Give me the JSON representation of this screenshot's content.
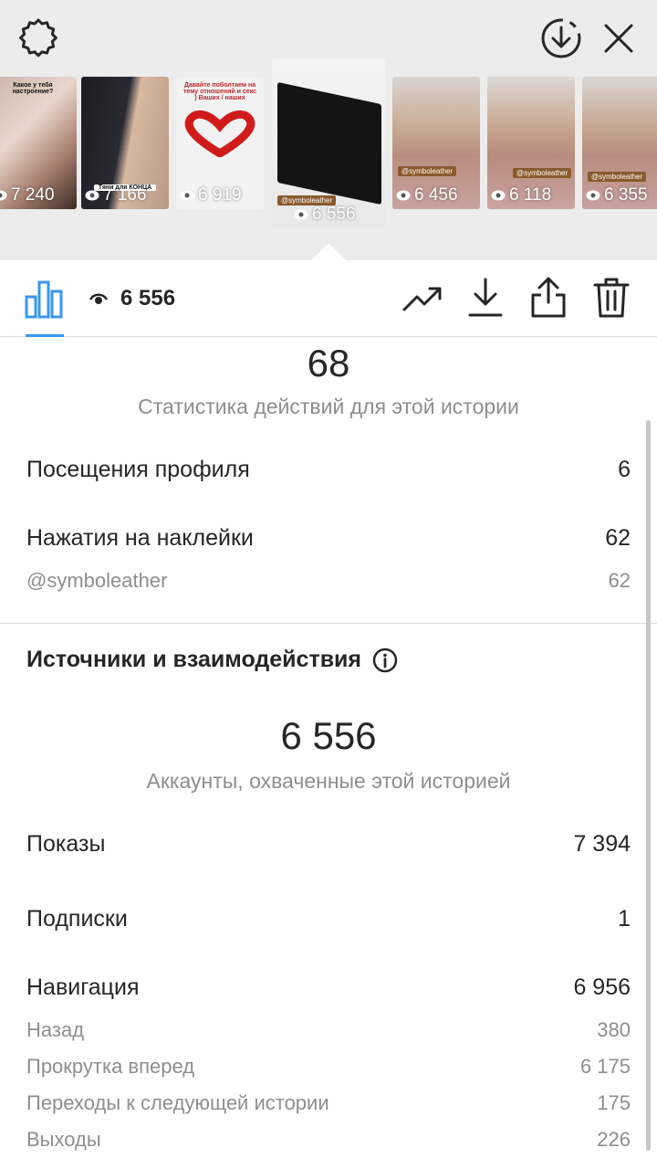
{
  "header": {
    "thumbnails": [
      {
        "views": "7 240",
        "caption": "Какое у тебя настроение?"
      },
      {
        "views": "7 166",
        "caption": "Тяни для КОНЦА"
      },
      {
        "views": "6 919",
        "caption": "Давайте поболтаем на тему отношений и секс ) Ваших / наших"
      },
      {
        "views": "6 556",
        "tag": "@symboleather"
      },
      {
        "views": "6 456",
        "tag": "@symboleather"
      },
      {
        "views": "6 118",
        "tag": "@symboleather"
      },
      {
        "views": "6 355",
        "tag": "@symboleather"
      }
    ]
  },
  "toolbar": {
    "view_count": "6 556"
  },
  "interactions": {
    "total": "68",
    "caption": "Статистика действий для этой истории",
    "profile_visits_label": "Посещения профиля",
    "profile_visits_value": "6",
    "sticker_taps_label": "Нажатия на наклейки",
    "sticker_taps_value": "62",
    "sticker_account_label": "@symboleather",
    "sticker_account_value": "62"
  },
  "discovery": {
    "title": "Источники и взаимодействия",
    "reach": "6 556",
    "reach_caption": "Аккаунты, охваченные этой историей",
    "impressions_label": "Показы",
    "impressions_value": "7 394",
    "follows_label": "Подписки",
    "follows_value": "1",
    "navigation_label": "Навигация",
    "navigation_value": "6 956",
    "back_label": "Назад",
    "back_value": "380",
    "forward_label": "Прокрутка вперед",
    "forward_value": "6 175",
    "next_story_label": "Переходы к следующей истории",
    "next_story_value": "175",
    "exited_label": "Выходы",
    "exited_value": "226"
  },
  "colors": {
    "accent": "#3897f0",
    "secondary_text": "#8e8e8e"
  }
}
